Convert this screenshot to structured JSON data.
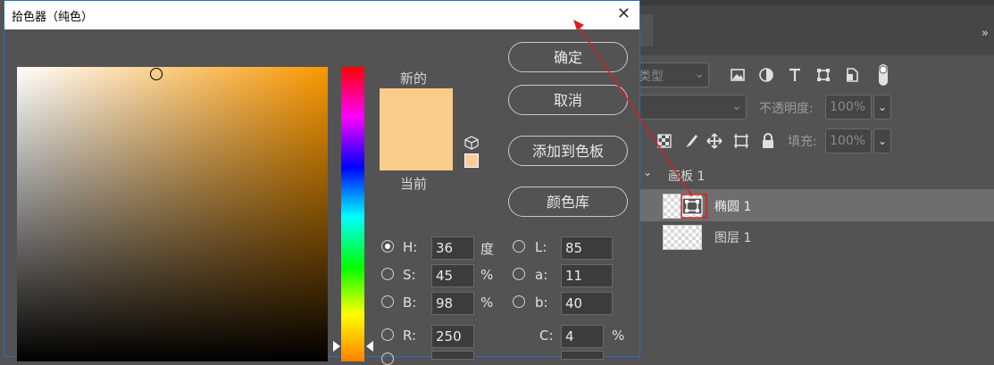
{
  "dialog": {
    "title": "拾色器（纯色）",
    "close_icon": "close-icon",
    "new_label": "新的",
    "current_label": "当前",
    "new_color": "#f8cc8a",
    "current_color": "#f8cc8a",
    "buttons": {
      "ok": "确定",
      "cancel": "取消",
      "add_swatch": "添加到色板",
      "color_libraries": "颜色库"
    },
    "fields": {
      "H": {
        "label": "H:",
        "value": "36",
        "unit": "度",
        "selected": true
      },
      "S": {
        "label": "S:",
        "value": "45",
        "unit": "%"
      },
      "B": {
        "label": "B:",
        "value": "98",
        "unit": "%"
      },
      "R": {
        "label": "R:",
        "value": "250"
      },
      "L": {
        "label": "L:",
        "value": "85"
      },
      "a": {
        "label": "a:",
        "value": "11"
      },
      "b": {
        "label": "b:",
        "value": "40"
      },
      "C": {
        "label": "C:",
        "value": "4",
        "unit": "%"
      }
    }
  },
  "layers_panel": {
    "menu_icon": "»",
    "kind_filter": "类型",
    "opacity_label": "不透明度:",
    "opacity_value": "100%",
    "fill_label": "填充:",
    "fill_value": "100%",
    "artboard": "画板 1",
    "layers": [
      "椭圆 1",
      "图层 1"
    ]
  },
  "colors": {
    "panel_bg": "#535353",
    "highlight": "#d42020",
    "accent_border": "#2a6cc4"
  }
}
